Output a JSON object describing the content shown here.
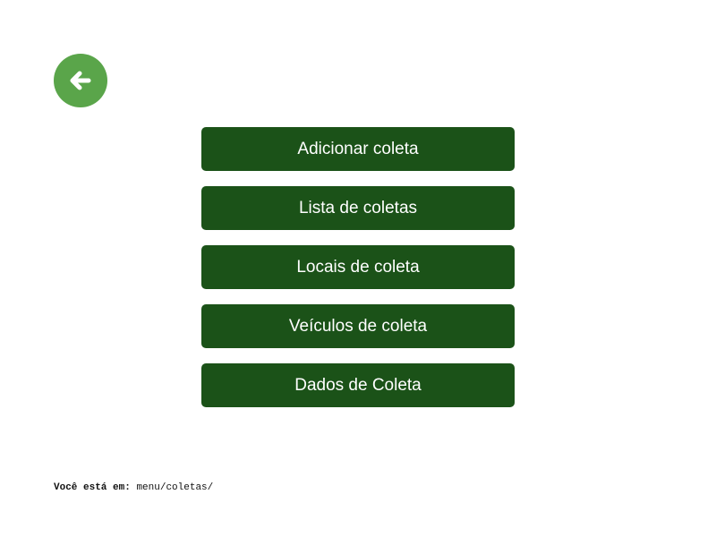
{
  "header": {
    "back_icon": "arrow-left-icon"
  },
  "menu": {
    "items": [
      {
        "label": "Adicionar coleta"
      },
      {
        "label": "Lista de coletas"
      },
      {
        "label": "Locais de coleta"
      },
      {
        "label": "Veículos de coleta"
      },
      {
        "label": "Dados de Coleta"
      }
    ]
  },
  "footer": {
    "location_label": "Você está em:",
    "location_path": "menu/coletas/"
  },
  "colors": {
    "back_button": "#5aa54a",
    "menu_button": "#1b5218",
    "button_text": "#ffffff",
    "background": "#ffffff"
  }
}
